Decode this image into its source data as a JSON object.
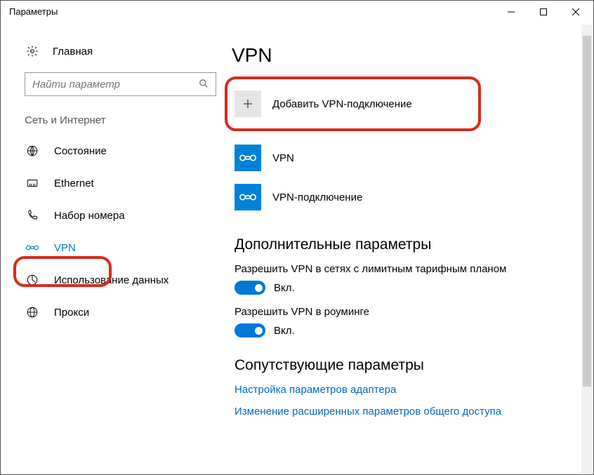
{
  "titlebar": {
    "title": "Параметры"
  },
  "sidebar": {
    "home": "Главная",
    "search_placeholder": "Найти параметр",
    "section": "Сеть и Интернет",
    "items": [
      {
        "id": "status",
        "label": "Состояние"
      },
      {
        "id": "ethernet",
        "label": "Ethernet"
      },
      {
        "id": "dialup",
        "label": "Набор номера"
      },
      {
        "id": "vpn",
        "label": "VPN",
        "active": true
      },
      {
        "id": "data",
        "label": "Использование данных"
      },
      {
        "id": "proxy",
        "label": "Прокси"
      }
    ]
  },
  "main": {
    "heading": "VPN",
    "add_label": "Добавить VPN-подключение",
    "connections": [
      {
        "label": "VPN"
      },
      {
        "label": "VPN-подключение"
      }
    ],
    "advanced_heading": "Дополнительные параметры",
    "toggle1_label": "Разрешить VPN в сетях с лимитным тарифным планом",
    "toggle1_state": "Вкл.",
    "toggle2_label": "Разрешить VPN в роуминге",
    "toggle2_state": "Вкл.",
    "related_heading": "Сопутствующие параметры",
    "link1": "Настройка параметров адаптера",
    "link2": "Изменение расширенных параметров общего доступа"
  }
}
